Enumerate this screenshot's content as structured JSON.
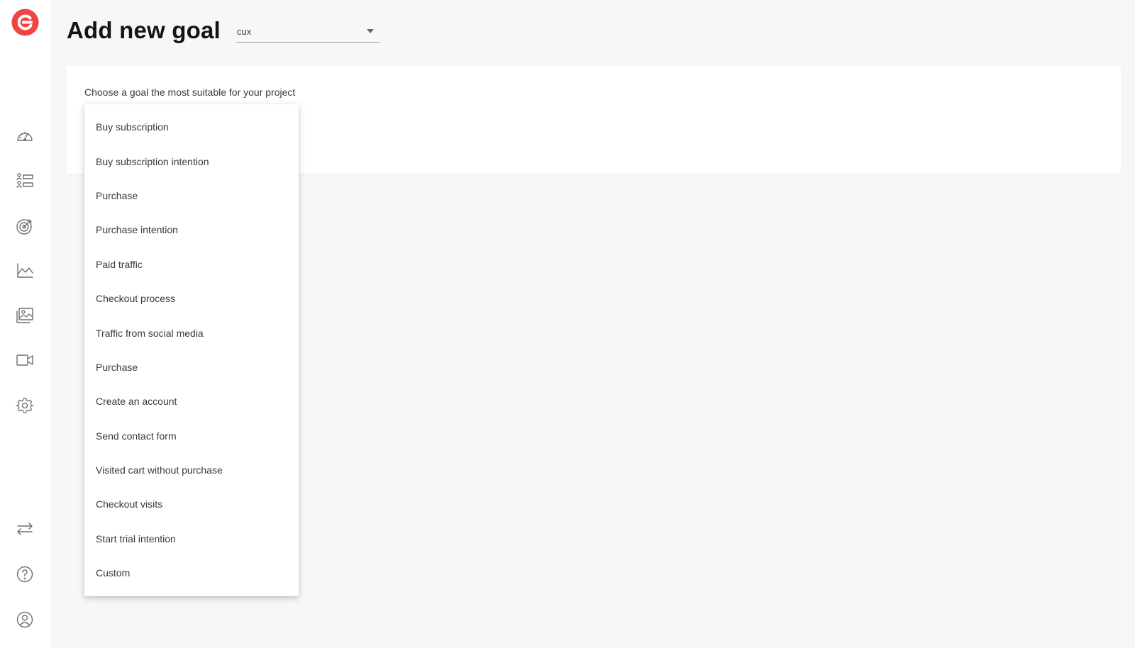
{
  "brand": {
    "accent": "#ef4444",
    "logo_icon": "cux-logo-icon"
  },
  "sidebar": {
    "items": [
      {
        "icon": "dashboard-gauge-icon"
      },
      {
        "icon": "user-list-icon"
      },
      {
        "icon": "target-goal-icon"
      },
      {
        "icon": "area-chart-icon"
      },
      {
        "icon": "gallery-images-icon"
      },
      {
        "icon": "video-camera-icon"
      },
      {
        "icon": "gear-icon"
      }
    ],
    "bottom_items": [
      {
        "icon": "swap-arrows-icon"
      },
      {
        "icon": "help-question-icon"
      },
      {
        "icon": "user-profile-icon"
      }
    ]
  },
  "header": {
    "title": "Add new goal",
    "project_select": {
      "value": "cux"
    }
  },
  "card": {
    "prompt": "Choose a goal the most suitable for your project"
  },
  "goal_dropdown": {
    "options": [
      "Buy subscription",
      "Buy subscription intention",
      "Purchase",
      "Purchase intention",
      "Paid traffic",
      "Checkout process",
      "Traffic from social media",
      "Purchase",
      "Create an account",
      "Send contact form",
      "Visited cart without purchase",
      "Checkout visits",
      "Start trial intention",
      "Custom"
    ]
  }
}
